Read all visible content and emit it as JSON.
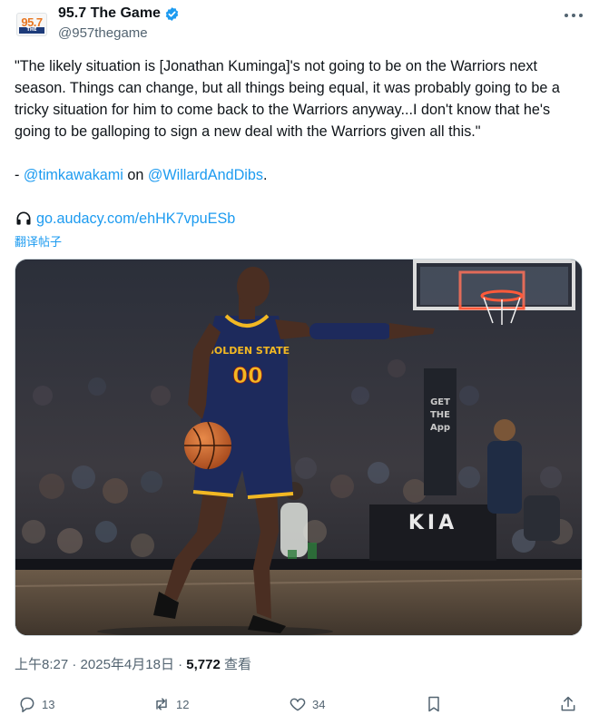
{
  "author": {
    "display_name": "95.7 The Game",
    "handle": "@957thegame",
    "avatar_top": "95.7",
    "avatar_bottom": "THE GAME"
  },
  "tweet": {
    "text": "\"The likely situation is [Jonathan Kuminga]'s not going to be on the Warriors next season. Things can change, but all things being equal, it was probably going to be a tricky situation for him to come back to the Warriors anyway...I don't know that he's going to be galloping to sign a new deal with the Warriors given all this.\"",
    "dash": "- ",
    "mention_1": "@timkawakami",
    "on_word": " on ",
    "mention_2": "@WillardAndDibs",
    "period": ".",
    "link": "go.audacy.com/ehHK7vpuESb",
    "translate": "翻译帖子"
  },
  "photo": {
    "jersey_text": "GOLDEN STATE",
    "jersey_number": "00",
    "sponsor_text": "KIA"
  },
  "meta": {
    "time": "上午8:27",
    "sep1": " · ",
    "date": "2025年4月18日",
    "sep2": " · ",
    "views_count": "5,772",
    "views_label": " 查看"
  },
  "actions": {
    "replies": "13",
    "reposts": "12",
    "likes": "34"
  },
  "colors": {
    "link": "#1d9bf0",
    "secondary_text": "#536471",
    "warriors_navy": "#1d2a5c",
    "warriors_gold": "#f2b823"
  }
}
